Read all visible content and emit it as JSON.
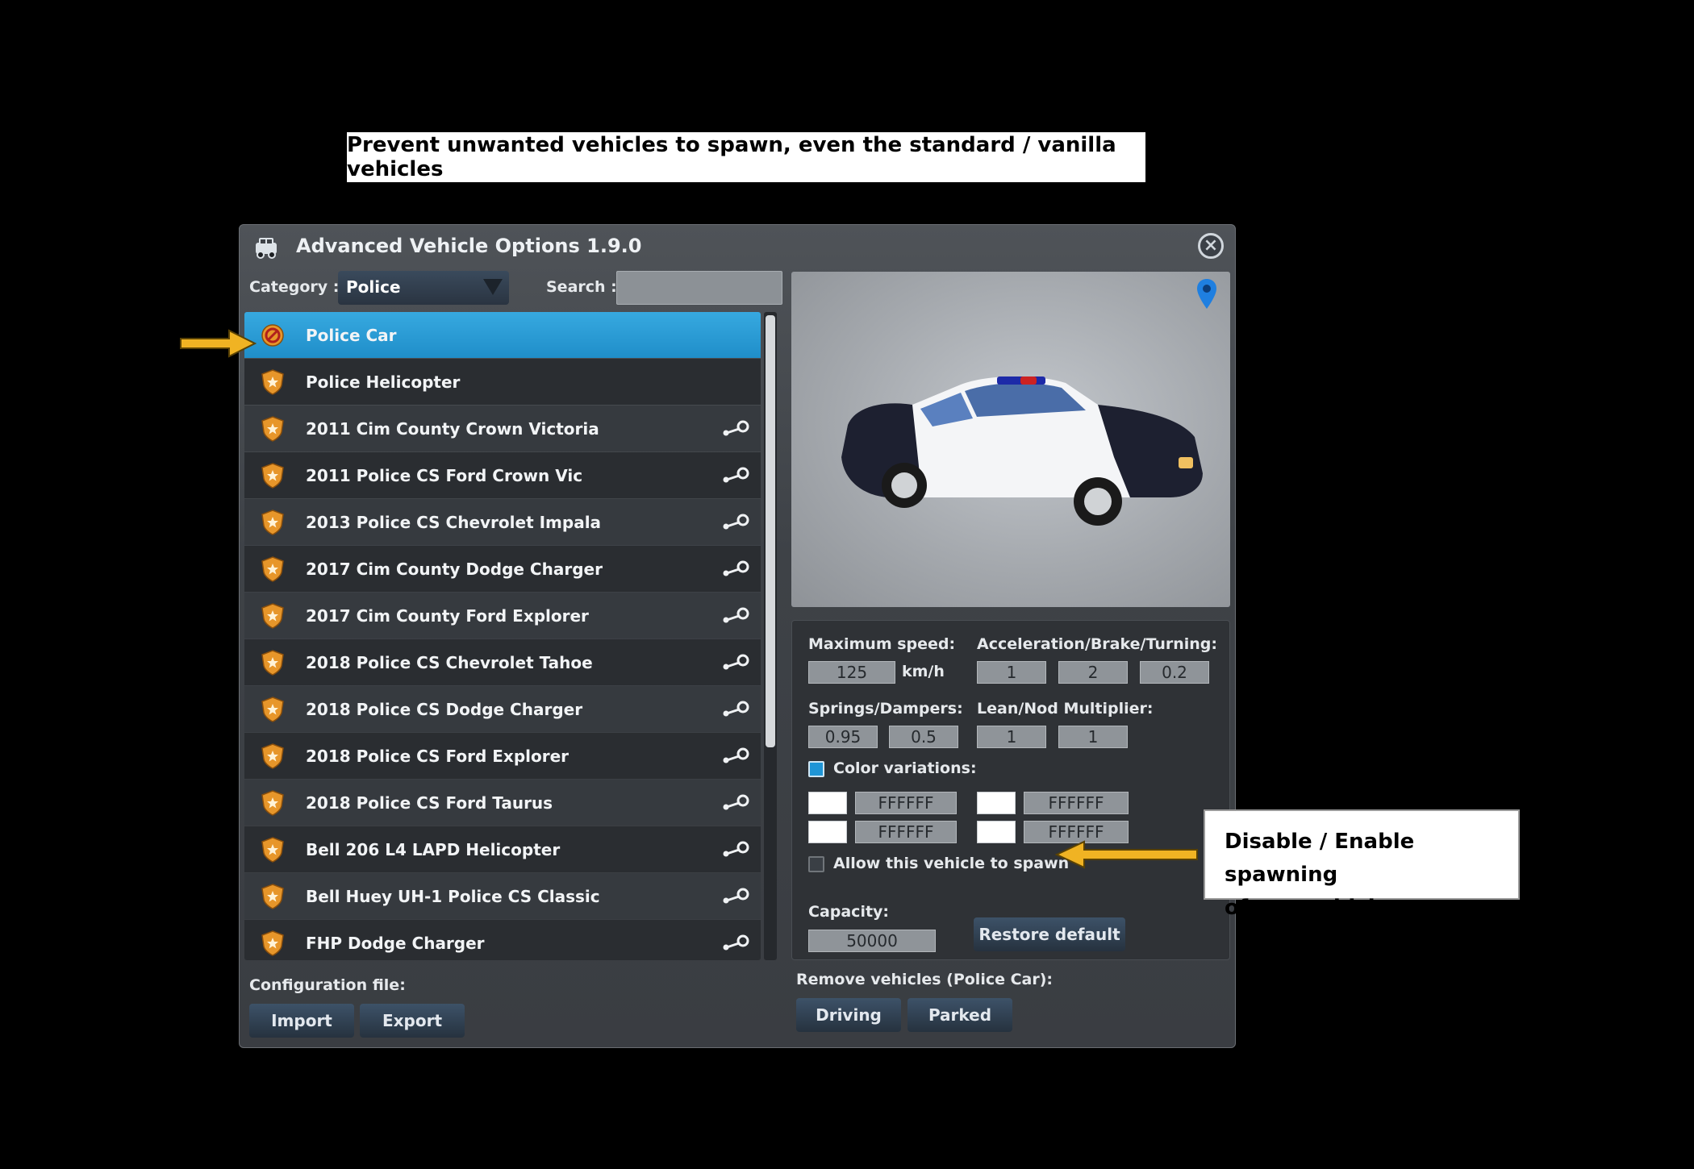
{
  "annotations": {
    "top_callout": "Prevent unwanted vehicles to spawn, even the standard / vanilla vehicles",
    "side_callout_line1": "Disable / Enable spawning",
    "side_callout_line2": "of any vehicle"
  },
  "window": {
    "title": "Advanced Vehicle Options 1.9.0",
    "category_label": "Category :",
    "category_value": "Police",
    "search_label": "Search :",
    "search_value": ""
  },
  "vehicles": [
    {
      "name": "Police Car",
      "icon": "not-allowed-badge-icon",
      "workshop": false,
      "selected": true
    },
    {
      "name": "Police Helicopter",
      "icon": "police-badge-icon",
      "workshop": false
    },
    {
      "name": "2011 Cim County Crown Victoria",
      "icon": "police-badge-icon",
      "workshop": true
    },
    {
      "name": "2011 Police CS Ford Crown Vic",
      "icon": "police-badge-icon",
      "workshop": true
    },
    {
      "name": "2013 Police CS Chevrolet Impala",
      "icon": "police-badge-icon",
      "workshop": true
    },
    {
      "name": "2017 Cim County Dodge Charger",
      "icon": "police-badge-icon",
      "workshop": true
    },
    {
      "name": "2017 Cim County Ford Explorer",
      "icon": "police-badge-icon",
      "workshop": true
    },
    {
      "name": "2018 Police CS Chevrolet Tahoe",
      "icon": "police-badge-icon",
      "workshop": true
    },
    {
      "name": "2018 Police CS Dodge Charger",
      "icon": "police-badge-icon",
      "workshop": true
    },
    {
      "name": "2018 Police CS Ford Explorer",
      "icon": "police-badge-icon",
      "workshop": true
    },
    {
      "name": "2018 Police CS Ford Taurus",
      "icon": "police-badge-icon",
      "workshop": true
    },
    {
      "name": "Bell 206 L4 LAPD Helicopter",
      "icon": "police-badge-icon",
      "workshop": true
    },
    {
      "name": "Bell Huey UH-1 Police CS Classic",
      "icon": "police-badge-icon",
      "workshop": true
    },
    {
      "name": "FHP Dodge Charger",
      "icon": "police-badge-icon",
      "workshop": true
    }
  ],
  "properties": {
    "max_speed_label": "Maximum speed:",
    "max_speed_value": "125",
    "max_speed_unit": "km/h",
    "accel_label": "Acceleration/Brake/Turning:",
    "accel_value": "1",
    "brake_value": "2",
    "turning_value": "0.2",
    "springs_label": "Springs/Dampers:",
    "springs_value": "0.95",
    "dampers_value": "0.5",
    "lean_label": "Lean/Nod Multiplier:",
    "lean_value": "1",
    "nod_value": "1",
    "color_variations_label": "Color variations:",
    "color_variations_checked": true,
    "colors": [
      "FFFFFF",
      "FFFFFF",
      "FFFFFF",
      "FFFFFF"
    ],
    "allow_spawn_label": "Allow this vehicle to spawn",
    "allow_spawn_checked": false,
    "capacity_label": "Capacity:",
    "capacity_value": "50000",
    "restore_label": "Restore default"
  },
  "config": {
    "label": "Configuration file:",
    "import_label": "Import",
    "export_label": "Export"
  },
  "remove": {
    "label": "Remove vehicles (Police Car):",
    "driving_label": "Driving",
    "parked_label": "Parked"
  },
  "colors": {
    "selected_row": "#1f8ec9",
    "arrow": "#f0b323",
    "badge": "#e7962a"
  }
}
